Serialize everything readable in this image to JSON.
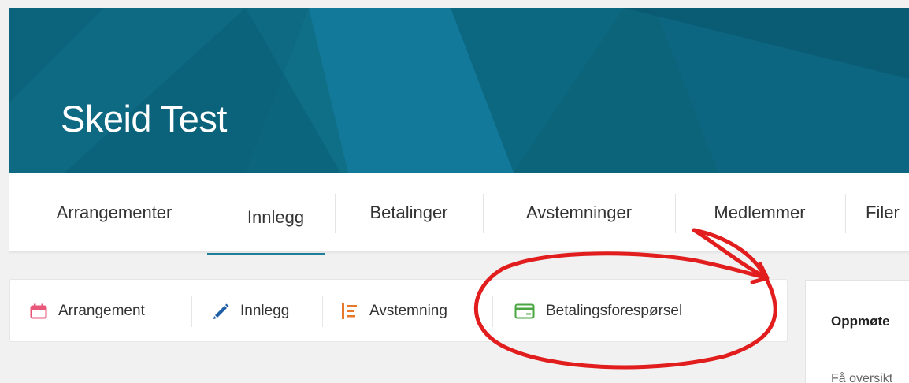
{
  "banner": {
    "title": "Skeid Test",
    "color": "#0f6f87"
  },
  "tabs": [
    {
      "label": "Arrangementer"
    },
    {
      "label": "Innlegg",
      "active": true
    },
    {
      "label": "Betalinger"
    },
    {
      "label": "Avstemninger"
    },
    {
      "label": "Medlemmer"
    },
    {
      "label": "Filer"
    }
  ],
  "actions": [
    {
      "label": "Arrangement",
      "icon": "calendar-icon",
      "color": "#e8577a"
    },
    {
      "label": "Innlegg",
      "icon": "pencil-icon",
      "color": "#1f5fa8"
    },
    {
      "label": "Avstemning",
      "icon": "poll-icon",
      "color": "#e8782a"
    },
    {
      "label": "Betalingsforespørsel",
      "icon": "credit-card-icon",
      "color": "#4aa640"
    }
  ],
  "side_card": {
    "title": "Oppmøte",
    "text": "Få oversikt"
  },
  "annotation": {
    "color": "#e11d1d"
  }
}
